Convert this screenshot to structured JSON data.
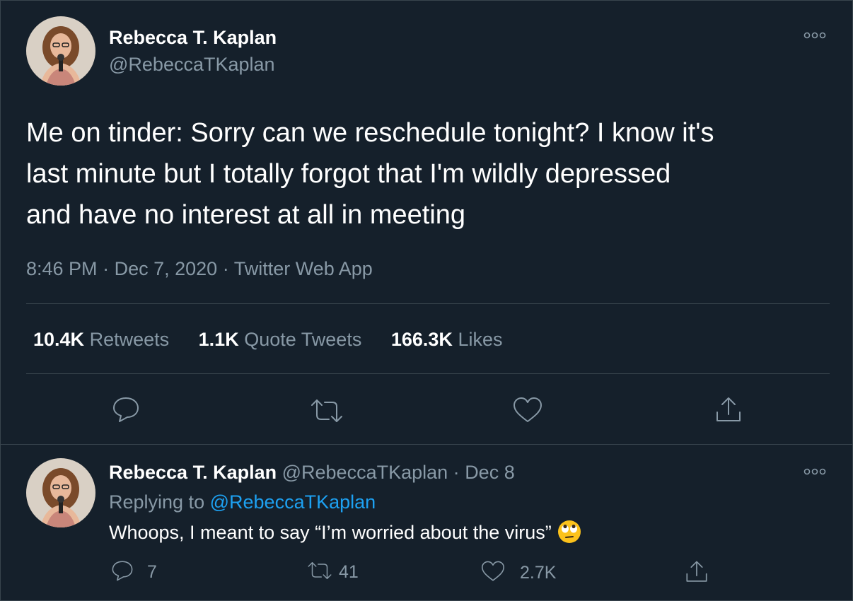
{
  "tweet": {
    "author_name": "Rebecca T. Kaplan",
    "author_handle": "@RebeccaTKaplan",
    "text_line1": "Me on tinder: Sorry can we reschedule tonight? I know it's",
    "text_line2": "last minute but I totally forgot that I'm wildly depressed",
    "text_line3": "and have no interest at all in meeting",
    "time": "8:46 PM",
    "dot": "·",
    "date": "Dec 7, 2020",
    "source": "Twitter Web App",
    "retweets_count": "10.4K",
    "retweets_label": "Retweets",
    "quotes_count": "1.1K",
    "quotes_label": "Quote Tweets",
    "likes_count": "166.3K",
    "likes_label": "Likes",
    "actions": [
      "reply-icon",
      "retweet-icon",
      "heart-icon",
      "share-icon"
    ]
  },
  "reply": {
    "author_name": "Rebecca T. Kaplan",
    "author_handle": "@RebeccaTKaplan",
    "dot": "·",
    "date": "Dec 8",
    "replying_prefix": "Replying to",
    "replying_handle": "@RebeccaTKaplan",
    "text": "Whoops, I meant to say “I’m worried about the virus”",
    "emoji": "face-with-rolling-eyes",
    "reply_count": "7",
    "retweet_count": "41",
    "like_count": "2.7K"
  },
  "colors": {
    "background": "#15202b",
    "border": "#38444d",
    "muted_text": "#8899a6",
    "link": "#1da1f2"
  }
}
